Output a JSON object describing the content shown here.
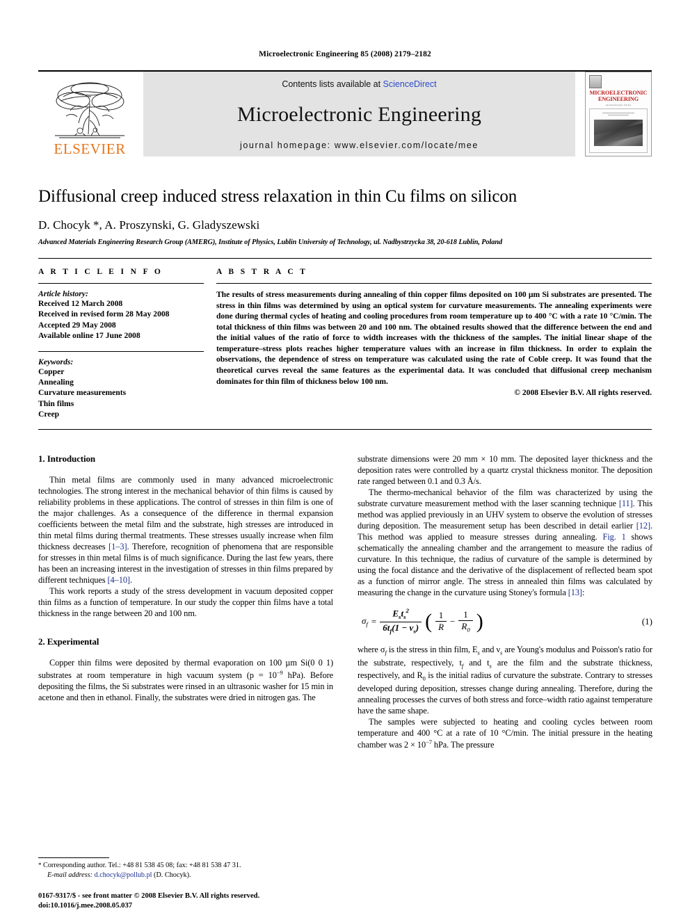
{
  "running_head": "Microelectronic Engineering 85 (2008) 2179–2182",
  "banner": {
    "publisher": "ELSEVIER",
    "contents_prefix": "Contents lists available at ",
    "contents_link": "ScienceDirect",
    "journal_title": "Microelectronic Engineering",
    "homepage": "journal homepage: www.elsevier.com/locate/mee",
    "cover_title": "MICROELECTRONIC ENGINEERING",
    "cover_subtitle": "An International Journal"
  },
  "title": "Diffusional creep induced stress relaxation in thin Cu films on silicon",
  "authors": "D. Chocyk *, A. Proszynski, G. Gladyszewski",
  "affiliation": "Advanced Materials Engineering Research Group (AMERG), Institute of Physics, Lublin University of Technology, ul. Nadbystrzycka 38, 20-618 Lublin, Poland",
  "article_info": {
    "heading": "A R T I C L E    I N F O",
    "history_label": "Article history:",
    "history": [
      "Received 12 March 2008",
      "Received in revised form 28 May 2008",
      "Accepted 29 May 2008",
      "Available online 17 June 2008"
    ],
    "keywords_label": "Keywords:",
    "keywords": [
      "Copper",
      "Annealing",
      "Curvature measurements",
      "Thin films",
      "Creep"
    ]
  },
  "abstract": {
    "heading": "A B S T R A C T",
    "text": "The results of stress measurements during annealing of thin copper films deposited on 100 µm Si substrates are presented. The stress in thin films was determined by using an optical system for curvature measurements. The annealing experiments were done during thermal cycles of heating and cooling procedures from room temperature up to 400 °C with a rate 10 °C/min. The total thickness of thin films was between 20 and 100 nm. The obtained results showed that the difference between the end and the initial values of the ratio of force to width increases with the thickness of the samples. The initial linear shape of the temperature–stress plots reaches higher temperature values with an increase in film thickness. In order to explain the observations, the dependence of stress on temperature was calculated using the rate of Coble creep. It was found that the theoretical curves reveal the same features as the experimental data. It was concluded that diffusional creep mechanism dominates for thin film of thickness below 100 nm.",
    "copyright": "© 2008 Elsevier B.V. All rights reserved."
  },
  "sections": {
    "intro_heading": "1. Introduction",
    "intro_p1_a": "Thin metal films are commonly used in many advanced microelectronic technologies. The strong interest in the mechanical behavior of thin films is caused by reliability problems in these applications. The control of stresses in thin film is one of the major challenges. As a consequence of the difference in thermal expansion coefficients between the metal film and the substrate, high stresses are introduced in thin metal films during thermal treatments. These stresses usually increase when film thickness decreases ",
    "intro_cite1": "[1–3]",
    "intro_p1_b": ". Therefore, recognition of phenomena that are responsible for stresses in thin metal films is of much significance. During the last few years, there has been an increasing interest in the investigation of stresses in thin films prepared by different techniques ",
    "intro_cite2": "[4–10]",
    "intro_p1_c": ".",
    "intro_p2": "This work reports a study of the stress development in vacuum deposited copper thin films as a function of temperature. In our study the copper thin films have a total thickness in the range between 20 and 100 nm.",
    "exp_heading": "2. Experimental",
    "exp_p1_a": "Copper thin films were deposited by thermal evaporation on 100 µm Si(0 0 1) substrates at room temperature in high vacuum system (p = 10",
    "exp_p1_exp": "−9",
    "exp_p1_b": " hPa). Before depositing the films, the Si substrates were rinsed in an ultrasonic washer for 15 min in acetone and then in ethanol. Finally, the substrates were dried in nitrogen gas. The",
    "right_p1": "substrate dimensions were 20 mm × 10 mm. The deposited layer thickness and the deposition rates were controlled by a quartz crystal thickness monitor. The deposition rate ranged between 0.1 and 0.3 Å/s.",
    "right_p2_a": "The thermo-mechanical behavior of the film was characterized by using the substrate curvature measurement method with the laser scanning technique ",
    "right_cite11": "[11]",
    "right_p2_b": ". This method was applied previously in an UHV system to observe the evolution of stresses during deposition. The measurement setup has been described in detail earlier ",
    "right_cite12": "[12]",
    "right_p2_c": ". This method was applied to measure stresses during annealing. ",
    "right_fig1": "Fig. 1",
    "right_p2_d": " shows schematically the annealing chamber and the arrangement to measure the radius of curvature. In this technique, the radius of curvature of the sample is determined by using the focal distance and the derivative of the displacement of reflected beam spot as a function of mirror angle. The stress in annealed thin films was calculated by measuring the change in the curvature using Stoney's formula ",
    "right_cite13": "[13]",
    "right_p2_e": ":",
    "right_p3_a": "where σ",
    "right_p3_b": " is the stress in thin film, E",
    "right_p3_c": " and ν",
    "right_p3_d": " are Young's modulus and Poisson's ratio for the substrate, respectively, t",
    "right_p3_e": " and t",
    "right_p3_f": " are the film and the substrate thickness, respectively, and R",
    "right_p3_g": " is the initial radius of curvature the substrate. Contrary to stresses developed during deposition, stresses change during annealing. Therefore, during the annealing processes the curves of both stress and force–width ratio against temperature have the same shape.",
    "right_p4_a": "The samples were subjected to heating and cooling cycles between room temperature and 400 °C at a rate of 10 °C/min. The initial pressure in the heating chamber was 2 × 10",
    "right_p4_exp": "−7",
    "right_p4_b": " hPa. The pressure"
  },
  "equation": {
    "lhs_sigma": "σ",
    "lhs_sub": "f",
    "equals": "=",
    "num_E": "E",
    "num_E_sub": "s",
    "num_t": "t",
    "num_t_sub": "s",
    "num_t_sup": "2",
    "den_pre": "6t",
    "den_sub": "f",
    "den_rest": "(1 − ν",
    "den_sub2": "s",
    "den_close": ")",
    "frac1_num": "1",
    "frac1_den": "R",
    "minus": "−",
    "frac2_num": "1",
    "frac2_den": "R",
    "frac2_den_sub": "0",
    "number": "(1)"
  },
  "footnote": {
    "mark": "*",
    "corresponding": " Corresponding author. Tel.: +48 81 538 45 08; fax: +48 81 538 47 31.",
    "email_label": "E-mail address:",
    "email": "d.chocyk@pollub.pl",
    "email_owner": " (D. Chocyk)."
  },
  "imprint": {
    "line1": "0167-9317/$ - see front matter © 2008 Elsevier B.V. All rights reserved.",
    "line2": "doi:10.1016/j.mee.2008.05.037"
  }
}
